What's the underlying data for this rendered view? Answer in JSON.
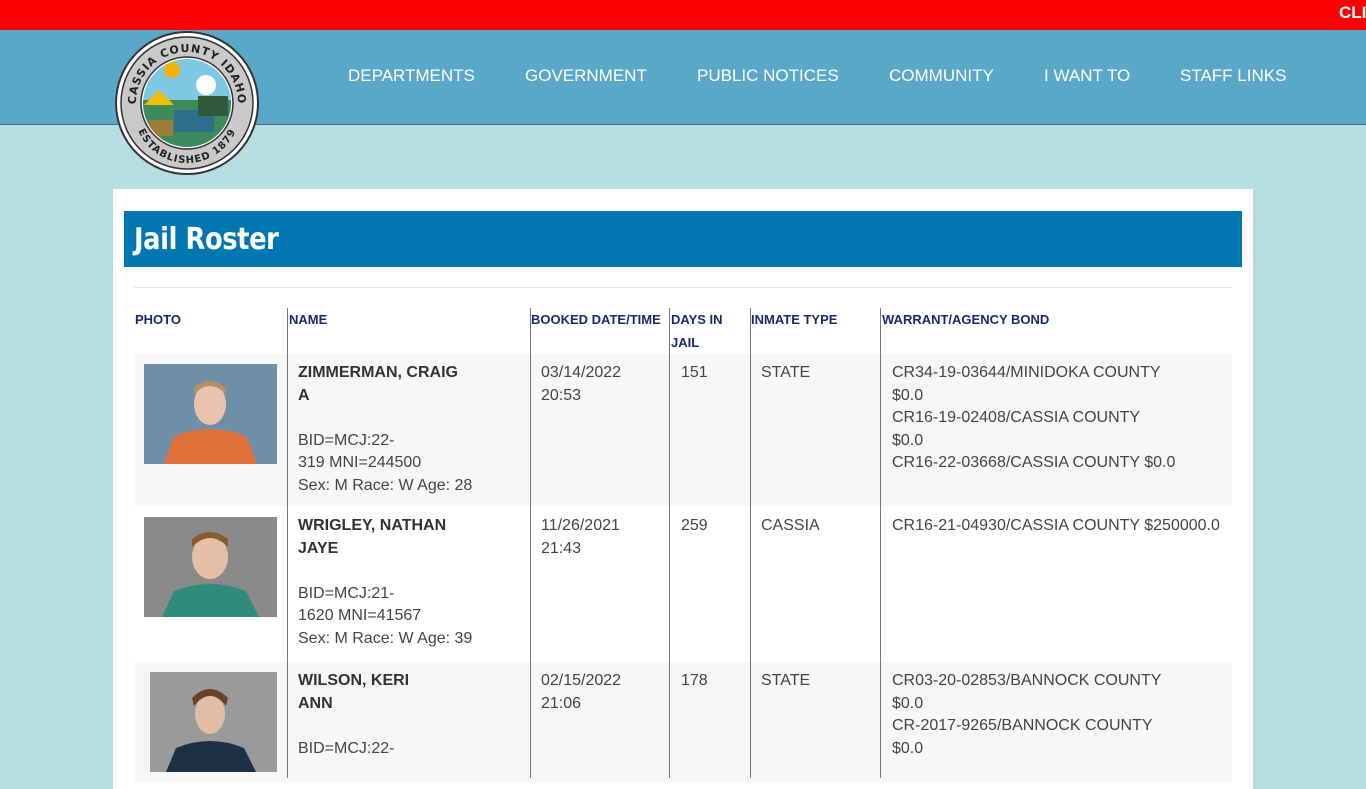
{
  "alert": {
    "text": "CLI"
  },
  "header": {
    "nav": [
      "DEPARTMENTS",
      "GOVERNMENT",
      "PUBLIC NOTICES",
      "COMMUNITY",
      "I WANT TO",
      "STAFF LINKS"
    ],
    "seal": {
      "top": "CASSIA COUNTY IDAHO",
      "bottom": "ESTABLISHED 1879"
    }
  },
  "page": {
    "title": "Jail Roster"
  },
  "table": {
    "headers": [
      "PHOTO",
      "NAME",
      "BOOKED DATE/TIME",
      "DAYS IN",
      "JAIL",
      "INMATE TYPE",
      "WARRANT/AGENCY BOND"
    ],
    "rows": [
      {
        "name1": "ZIMMERMAN, CRAIG",
        "name2": "A",
        "bid1": "BID=MCJ:22-",
        "bid2": "319  MNI=244500",
        "sex": "Sex: M  Race: W  Age: 28",
        "date": "03/14/2022",
        "time": "20:53",
        "days": "151",
        "type": "STATE",
        "warrants": [
          "CR34-19-03644/MINIDOKA COUNTY",
          "$0.0",
          "CR16-19-02408/CASSIA COUNTY",
          "$0.0",
          "CR16-22-03668/CASSIA COUNTY $0.0"
        ]
      },
      {
        "name1": "WRIGLEY, NATHAN",
        "name2": "JAYE",
        "bid1": "BID=MCJ:21-",
        "bid2": "1620  MNI=41567",
        "sex": "Sex: M  Race: W  Age: 39",
        "date": "11/26/2021",
        "time": "21:43",
        "days": "259",
        "type": "CASSIA",
        "warrants": [
          "CR16-21-04930/CASSIA COUNTY $250000.0"
        ]
      },
      {
        "name1": "WILSON, KERI",
        "name2": "ANN",
        "bid1": "BID=MCJ:22-",
        "bid2": "",
        "date": "02/15/2022",
        "time": "21:06",
        "days": "178",
        "type": "STATE",
        "warrants": [
          "CR03-20-02853/BANNOCK COUNTY",
          "$0.0",
          "CR-2017-9265/BANNOCK COUNTY",
          "$0.0"
        ]
      }
    ]
  },
  "colors": {
    "alert": "#ff0000",
    "header": "#5aa8c8",
    "title_bar": "#0077b0",
    "background": "#b6dde1"
  }
}
